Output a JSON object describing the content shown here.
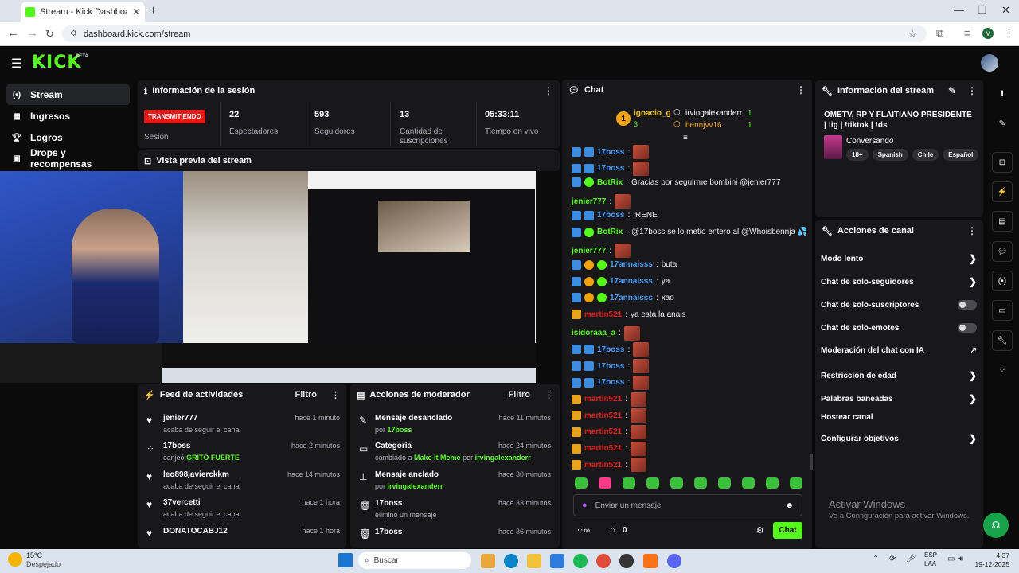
{
  "browser": {
    "tab_title": "Stream - Kick Dashboard",
    "url": "dashboard.kick.com/stream",
    "profile_initial": "M"
  },
  "header": {
    "logo": "KICK",
    "beta": "BETA"
  },
  "sidebar": {
    "items": [
      {
        "label": "Stream",
        "icon": "stream-icon"
      },
      {
        "label": "Ingresos",
        "icon": "income-icon"
      },
      {
        "label": "Logros",
        "icon": "trophy-icon"
      },
      {
        "label": "Drops y recompensas",
        "icon": "gift-icon"
      }
    ]
  },
  "session": {
    "title": "Información de la sesión",
    "live_badge": "TRANSMITIENDO",
    "live_label": "Sesión",
    "stats": [
      {
        "value": "22",
        "label": "Espectadores"
      },
      {
        "value": "593",
        "label": "Seguidores"
      },
      {
        "value": "13",
        "label": "Cantidad de suscripciones"
      },
      {
        "value": "05:33:11",
        "label": "Tiempo en vivo"
      }
    ]
  },
  "preview": {
    "title": "Vista previa del stream"
  },
  "feed": {
    "title": "Feed de actividades",
    "filter": "Filtro",
    "items": [
      {
        "name": "jenier777",
        "sub": "acaba de seguir el canal",
        "time": "hace 1 minuto",
        "icon": "heart-icon"
      },
      {
        "name": "17boss",
        "sub": "canjeó ",
        "highlight": "GRITO FUERTE",
        "time": "hace 2 minutos",
        "icon": "points-icon"
      },
      {
        "name": "leo898javierckkm",
        "sub": "acaba de seguir el canal",
        "time": "hace 14 minutos",
        "icon": "heart-icon"
      },
      {
        "name": "37vercetti",
        "sub": "acaba de seguir el canal",
        "time": "hace 1 hora",
        "icon": "heart-icon"
      },
      {
        "name": "DONATOCABJ12",
        "sub": "",
        "time": "hace 1 hora",
        "icon": "heart-icon"
      }
    ]
  },
  "modactions": {
    "title": "Acciones de moderador",
    "filter": "Filtro",
    "items": [
      {
        "name": "Mensaje desanclado",
        "pre": "por ",
        "green": "17boss",
        "mid": "",
        "green2": "",
        "time": "hace 11 minutos",
        "icon": "unpin-icon"
      },
      {
        "name": "Categoría",
        "pre": "cambiado a ",
        "green": "Make it Meme",
        "mid": " por ",
        "green2": "irvingalexanderr",
        "time": "hace 24 minutos",
        "icon": "category-icon"
      },
      {
        "name": "Mensaje anclado",
        "pre": "por ",
        "green": "irvingalexanderr",
        "mid": "",
        "green2": "",
        "time": "hace 30 minutos",
        "icon": "pin-icon"
      },
      {
        "name": "17boss",
        "pre": "eliminó un mensaje",
        "green": "",
        "mid": "",
        "green2": "",
        "time": "hace 33 minutos",
        "icon": "trash-icon"
      },
      {
        "name": "17boss",
        "pre": "",
        "green": "",
        "mid": "",
        "green2": "",
        "time": "hace 36 minutos",
        "icon": "trash-icon"
      }
    ]
  },
  "chat": {
    "title": "Chat",
    "top_gifters": [
      {
        "rank": "1",
        "name": "ignacio_g",
        "count": "3"
      },
      {
        "name": "irvingalexanderr",
        "count": "1"
      },
      {
        "name": "bennjvv16",
        "count": "1"
      }
    ],
    "messages": [
      {
        "user": "17boss",
        "color": "blue",
        "badges": [
          "blue",
          "blue"
        ],
        "text": "",
        "emote": true
      },
      {
        "user": "17boss",
        "color": "blue",
        "badges": [
          "blue",
          "blue"
        ],
        "text": "",
        "emote": true
      },
      {
        "user": "BotRix",
        "color": "green",
        "badges": [
          "blue",
          "green"
        ],
        "text": "Gracias por seguirme bombini @jenier777",
        "emote": false
      },
      {
        "user": "jenier777",
        "color": "green",
        "badges": [],
        "text": "",
        "emote": true
      },
      {
        "user": "17boss",
        "color": "blue",
        "badges": [
          "blue",
          "blue"
        ],
        "text": "!RENE",
        "emote": false
      },
      {
        "user": "BotRix",
        "color": "green",
        "badges": [
          "blue",
          "green"
        ],
        "text": "@17boss se lo metio entero al @Whoisbennja 💦",
        "emote": false
      },
      {
        "user": "jenier777",
        "color": "green",
        "badges": [],
        "text": "",
        "emote": true
      },
      {
        "user": "17annaisss",
        "color": "blue",
        "badges": [
          "blue",
          "orange",
          "green"
        ],
        "text": "buta",
        "emote": false
      },
      {
        "user": "17annaisss",
        "color": "blue",
        "badges": [
          "blue",
          "orange",
          "green"
        ],
        "text": "ya",
        "emote": false
      },
      {
        "user": "17annaisss",
        "color": "blue",
        "badges": [
          "blue",
          "orange",
          "green"
        ],
        "text": "xao",
        "emote": false
      },
      {
        "user": "martin521",
        "color": "red",
        "badges": [
          "crown"
        ],
        "text": "ya esta la anais",
        "emote": false
      },
      {
        "user": "isidoraaa_a",
        "color": "green",
        "badges": [],
        "text": "",
        "emote": true
      },
      {
        "user": "17boss",
        "color": "blue",
        "badges": [
          "blue",
          "blue"
        ],
        "text": "",
        "emote": true
      },
      {
        "user": "17boss",
        "color": "blue",
        "badges": [
          "blue",
          "blue"
        ],
        "text": "",
        "emote": true
      },
      {
        "user": "17boss",
        "color": "blue",
        "badges": [
          "blue",
          "blue"
        ],
        "text": "",
        "emote": true
      },
      {
        "user": "martin521",
        "color": "red",
        "badges": [
          "crown"
        ],
        "text": "",
        "emote": true
      },
      {
        "user": "martin521",
        "color": "red",
        "badges": [
          "crown"
        ],
        "text": "",
        "emote": true
      },
      {
        "user": "martin521",
        "color": "red",
        "badges": [
          "crown"
        ],
        "text": "",
        "emote": true
      },
      {
        "user": "martin521",
        "color": "red",
        "badges": [
          "crown"
        ],
        "text": "",
        "emote": true
      },
      {
        "user": "martin521",
        "color": "red",
        "badges": [
          "crown"
        ],
        "text": "",
        "emote": true
      }
    ],
    "input_placeholder": "Enviar un mensaje",
    "points": "0",
    "send_label": "Chat"
  },
  "stream_info": {
    "title": "Información del stream",
    "stream_title": "OMETV, RP Y FLAITIANO PRESIDENTE | !ig | !tiktok | !ds",
    "category": "Conversando",
    "tags": [
      "18+",
      "Spanish",
      "Chile",
      "Español"
    ]
  },
  "channel_actions": {
    "title": "Acciones de canal",
    "items": [
      {
        "label": "Modo lento",
        "kind": "arrow"
      },
      {
        "label": "Chat de solo-seguidores",
        "kind": "arrow"
      },
      {
        "label": "Chat de solo-suscriptores",
        "kind": "toggle"
      },
      {
        "label": "Chat de solo-emotes",
        "kind": "toggle"
      },
      {
        "label": "Moderación del chat con IA",
        "kind": "external"
      },
      {
        "label": "Restricción de edad",
        "kind": "arrow"
      },
      {
        "label": "Palabras baneadas",
        "kind": "arrow"
      },
      {
        "label": "Hostear canal",
        "kind": "none"
      },
      {
        "label": "Configurar objetivos",
        "kind": "arrow"
      }
    ]
  },
  "watermark": {
    "line1": "Activar Windows",
    "line2": "Ve a Configuración para activar Windows."
  },
  "taskbar": {
    "temp": "15°C",
    "weather": "Despejado",
    "search": "Buscar",
    "lang1": "ESP",
    "lang2": "LAA",
    "time": "4:37",
    "date": "19-12-2025"
  },
  "colors": {
    "accent": "#53fc18",
    "panel": "#18181b",
    "live": "#e91916"
  }
}
